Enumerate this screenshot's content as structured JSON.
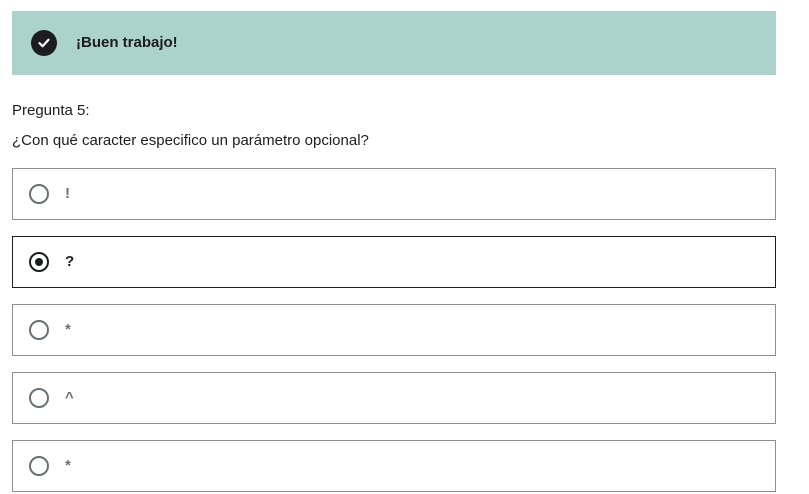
{
  "banner": {
    "text": "¡Buen trabajo!",
    "icon": "check-circle-icon",
    "color": "#acd2cc"
  },
  "question": {
    "label": "Pregunta 5:",
    "text": "¿Con qué caracter especifico un parámetro opcional?"
  },
  "options": [
    {
      "label": "!",
      "selected": false
    },
    {
      "label": "?",
      "selected": true
    },
    {
      "label": "*",
      "selected": false
    },
    {
      "label": "^",
      "selected": false
    },
    {
      "label": "*",
      "selected": false
    }
  ]
}
